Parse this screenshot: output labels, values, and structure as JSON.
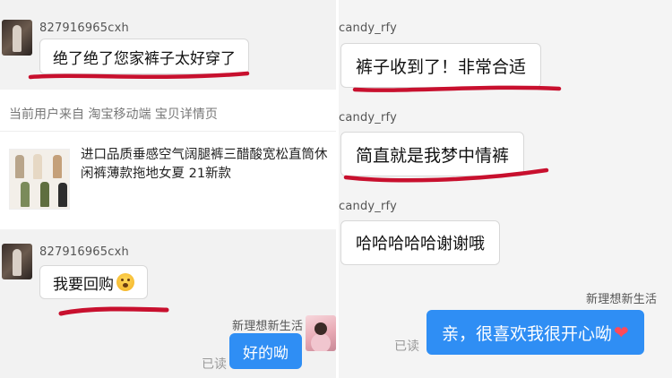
{
  "left": {
    "msg1": {
      "user": "827916965cxh",
      "text": "绝了绝了您家裤子太好穿了"
    },
    "product_card": {
      "source": "当前用户来自 淘宝移动端 宝贝详情页",
      "title": "进口品质垂感空气阔腿裤三醋酸宽松直筒休闲裤薄款拖地女夏 21新款"
    },
    "msg2": {
      "user": "827916965cxh",
      "text": "我要回购"
    },
    "reply": {
      "user": "新理想新生活",
      "text": "好的呦",
      "status": "已读"
    }
  },
  "right": {
    "msgs": [
      {
        "user": "candy_rfy",
        "text": "裤子收到了！非常合适"
      },
      {
        "user": "candy_rfy",
        "text": "简直就是我梦中情裤"
      },
      {
        "user": "candy_rfy",
        "text": "哈哈哈哈哈谢谢哦"
      }
    ],
    "reply": {
      "user": "新理想新生活",
      "text": "亲，很喜欢我很开心呦",
      "status": "已读"
    }
  },
  "icons": {
    "emoji": "astonished-face-emoji-icon",
    "heart": "red-heart-icon"
  },
  "colors": {
    "bubble_blue": "#2f8ef4",
    "underline_red": "#c8102e",
    "heart": "#ff4a5a"
  }
}
